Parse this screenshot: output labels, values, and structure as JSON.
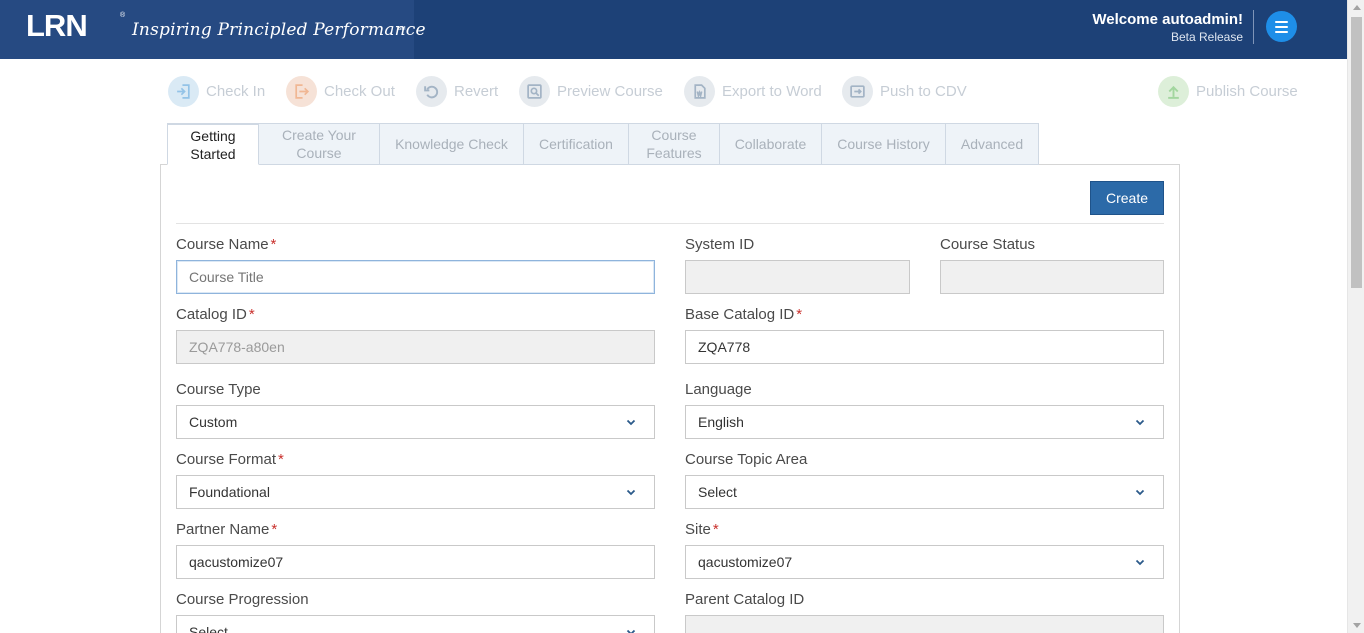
{
  "header": {
    "logo_text": "LRN",
    "logo_reg": "®",
    "tagline": "Inspiring Principled Performance",
    "tagline_mark": "SM",
    "welcome": "Welcome autoadmin!",
    "release": "Beta Release"
  },
  "toolbar": [
    {
      "label": "Check In",
      "icon": "check-in-icon"
    },
    {
      "label": "Check Out",
      "icon": "check-out-icon"
    },
    {
      "label": "Revert",
      "icon": "revert-icon"
    },
    {
      "label": "Preview Course",
      "icon": "preview-icon"
    },
    {
      "label": "Export to Word",
      "icon": "export-word-icon"
    },
    {
      "label": "Push to CDV",
      "icon": "push-cdv-icon"
    },
    {
      "label": "Publish Course",
      "icon": "publish-icon"
    }
  ],
  "tabs": [
    {
      "label": "Getting Started",
      "active": true
    },
    {
      "label": "Create Your Course",
      "active": false
    },
    {
      "label": "Knowledge Check",
      "active": false
    },
    {
      "label": "Certification",
      "active": false
    },
    {
      "label": "Course Features",
      "active": false
    },
    {
      "label": "Collaborate",
      "active": false
    },
    {
      "label": "Course History",
      "active": false
    },
    {
      "label": "Advanced",
      "active": false
    }
  ],
  "create_label": "Create",
  "required_mark": "*",
  "form": {
    "course_name": {
      "label": "Course Name",
      "placeholder": "Course Title",
      "value": ""
    },
    "system_id": {
      "label": "System ID",
      "value": ""
    },
    "course_status": {
      "label": "Course Status",
      "value": ""
    },
    "catalog_id": {
      "label": "Catalog ID",
      "value": "ZQA778-a80en"
    },
    "base_catalog_id": {
      "label": "Base Catalog ID",
      "value": "ZQA778"
    },
    "course_type": {
      "label": "Course Type",
      "value": "Custom"
    },
    "language": {
      "label": "Language",
      "value": "English"
    },
    "course_format": {
      "label": "Course Format",
      "value": "Foundational"
    },
    "course_topic_area": {
      "label": "Course Topic Area",
      "value": "Select"
    },
    "partner_name": {
      "label": "Partner Name",
      "value": "qacustomize07"
    },
    "site": {
      "label": "Site",
      "value": "qacustomize07"
    },
    "course_progression": {
      "label": "Course Progression",
      "value": "Select"
    },
    "parent_catalog_id": {
      "label": "Parent Catalog ID",
      "value": ""
    }
  },
  "colors": {
    "header_bg": "#1d4177",
    "brand_bg": "#264a82",
    "menu_button": "#1e8ee8",
    "primary_button": "#2c6aa8",
    "required": "#c9302c"
  }
}
